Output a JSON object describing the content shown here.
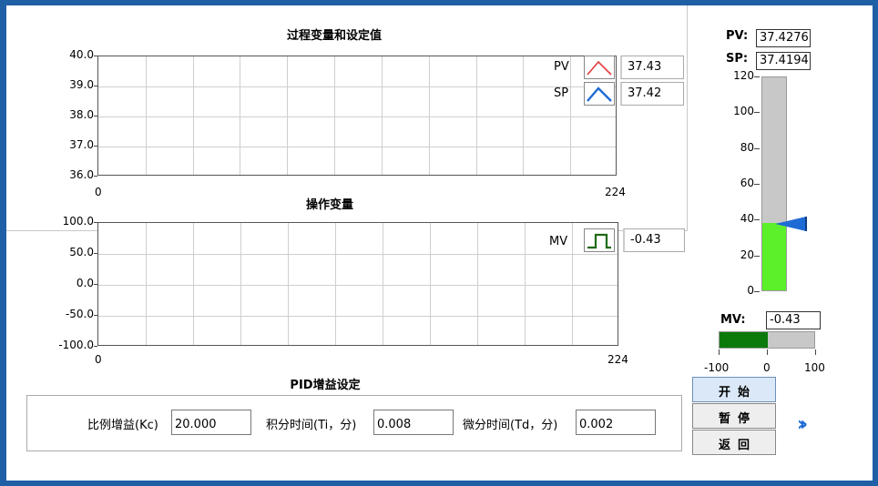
{
  "charts": {
    "pv_sp": {
      "title": "过程变量和设定值",
      "y_ticks": [
        "40.0",
        "39.0",
        "38.0",
        "37.0",
        "36.0"
      ],
      "x_ticks": [
        "0",
        "224"
      ],
      "legend": [
        {
          "label": "PV",
          "value": "37.43",
          "color": "#e53b3b",
          "icon": "line-triangle-icon"
        },
        {
          "label": "SP",
          "value": "37.42",
          "color": "#1f6bd6",
          "icon": "line-triangle-icon"
        }
      ]
    },
    "mv": {
      "title": "操作变量",
      "y_ticks": [
        "100.0",
        "50.0",
        "0.0",
        "-50.0",
        "-100.0"
      ],
      "x_ticks": [
        "0",
        "224"
      ],
      "legend": [
        {
          "label": "MV",
          "value": "-0.43",
          "color": "#1f6b12",
          "icon": "step-line-icon"
        }
      ]
    }
  },
  "indicators": {
    "pv_label": "PV:",
    "pv_value": "37.4276",
    "sp_label": "SP:",
    "sp_value": "37.4194",
    "tank_ticks": [
      "120",
      "100",
      "80",
      "60",
      "40",
      "20",
      "0"
    ],
    "tank_level": 37.43,
    "tank_max": 120,
    "mv_label": "MV:",
    "mv_value": "-0.43",
    "mv_ticks": [
      "-100",
      "0",
      "100"
    ],
    "mv_fill_from": -100,
    "mv_fill_to": -0.43
  },
  "pid": {
    "title": "PID增益设定",
    "kc_label": "比例增益(Kc)",
    "kc_value": "20.000",
    "ti_label": "积分时间(Ti，分)",
    "ti_value": "0.008",
    "td_label": "微分时间(Td，分)",
    "td_value": "0.002"
  },
  "buttons": {
    "start": "开始",
    "pause": "暂停",
    "back": "返回"
  },
  "colors": {
    "frame": "#1f5fa6",
    "tank_fill": "#5cf02a",
    "mv_fill": "#0b7a0b",
    "sp_marker": "#1f6bd6"
  }
}
